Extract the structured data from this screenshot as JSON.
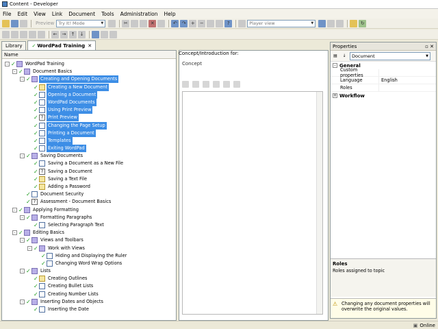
{
  "window": {
    "title": "Content - Developer"
  },
  "menu": [
    "File",
    "Edit",
    "View",
    "Link",
    "Document",
    "Tools",
    "Administration",
    "Help"
  ],
  "toolbar": {
    "preview_label": "Preview",
    "mode_combo": "Try It! Mode",
    "player_combo": "Player view"
  },
  "tabs": [
    {
      "label": "Library",
      "active": false
    },
    {
      "label": "WordPad Training",
      "active": true
    }
  ],
  "left_panel": {
    "column_header": "Name",
    "tree": [
      {
        "label": "WordPad Training",
        "level": 0,
        "expander": "-",
        "icon": "book",
        "selected": false
      },
      {
        "label": "Document Basics",
        "level": 1,
        "expander": "-",
        "icon": "book",
        "selected": false
      },
      {
        "label": "Creating and Opening Documents",
        "level": 2,
        "expander": "-",
        "icon": "book",
        "selected": true
      },
      {
        "label": "Creating a New Document",
        "level": 3,
        "expander": "",
        "icon": "quiz",
        "selected": true
      },
      {
        "label": "Opening a Document",
        "level": 3,
        "expander": "",
        "icon": "topic",
        "selected": true
      },
      {
        "label": "WordPad Documents",
        "level": 3,
        "expander": "",
        "icon": "topic",
        "selected": true
      },
      {
        "label": "Using Print Preview",
        "level": 3,
        "expander": "",
        "icon": "topic",
        "selected": true
      },
      {
        "label": "Print Preview",
        "level": 3,
        "expander": "",
        "icon": "tst",
        "selected": true
      },
      {
        "label": "Changing the Page Setup",
        "level": 3,
        "expander": "",
        "icon": "topic",
        "selected": true
      },
      {
        "label": "Printing a Document",
        "level": 3,
        "expander": "",
        "icon": "topic",
        "selected": true
      },
      {
        "label": "Templates",
        "level": 3,
        "expander": "",
        "icon": "topic",
        "selected": true
      },
      {
        "label": "Exiting WordPad",
        "level": 3,
        "expander": "",
        "icon": "topic",
        "selected": true
      },
      {
        "label": "Saving Documents",
        "level": 2,
        "expander": "-",
        "icon": "book",
        "selected": false
      },
      {
        "label": "Saving a Document as a New File",
        "level": 3,
        "expander": "",
        "icon": "topic",
        "selected": false
      },
      {
        "label": "Saving a Document",
        "level": 3,
        "expander": "",
        "icon": "tst",
        "selected": false
      },
      {
        "label": "Saving a Text File",
        "level": 3,
        "expander": "",
        "icon": "quiz",
        "selected": false
      },
      {
        "label": "Adding a Password",
        "level": 3,
        "expander": "",
        "icon": "quiz",
        "selected": false
      },
      {
        "label": "Document Security",
        "level": 2,
        "expander": "",
        "icon": "topic",
        "selected": false
      },
      {
        "label": "Assessment - Document Basics",
        "level": 2,
        "expander": "",
        "icon": "tst",
        "selected": false
      },
      {
        "label": "Applying Formatting",
        "level": 1,
        "expander": "-",
        "icon": "book",
        "selected": false
      },
      {
        "label": "Formatting Paragraphs",
        "level": 2,
        "expander": "-",
        "icon": "book",
        "selected": false
      },
      {
        "label": "Selecting Paragraph Text",
        "level": 3,
        "expander": "",
        "icon": "topic",
        "selected": false
      },
      {
        "label": "Editing Basics",
        "level": 1,
        "expander": "-",
        "icon": "book",
        "selected": false
      },
      {
        "label": "Views and Toolbars",
        "level": 2,
        "expander": "-",
        "icon": "book",
        "selected": false
      },
      {
        "label": "Work with Views",
        "level": 3,
        "expander": "-",
        "icon": "book",
        "selected": false
      },
      {
        "label": "Hiding and Displaying the Ruler",
        "level": 4,
        "expander": "",
        "icon": "topic",
        "selected": false
      },
      {
        "label": "Changing Word Wrap Options",
        "level": 4,
        "expander": "",
        "icon": "topic",
        "selected": false
      },
      {
        "label": "Lists",
        "level": 2,
        "expander": "-",
        "icon": "book",
        "selected": false
      },
      {
        "label": "Creating Outlines",
        "level": 3,
        "expander": "",
        "icon": "quiz",
        "selected": false
      },
      {
        "label": "Creating Bullet Lists",
        "level": 3,
        "expander": "",
        "icon": "topic",
        "selected": false
      },
      {
        "label": "Creating Number Lists",
        "level": 3,
        "expander": "",
        "icon": "topic",
        "selected": false
      },
      {
        "label": "Inserting Dates and Objects",
        "level": 2,
        "expander": "-",
        "icon": "book",
        "selected": false
      },
      {
        "label": "Inserting the Date",
        "level": 3,
        "expander": "",
        "icon": "topic",
        "selected": false
      }
    ]
  },
  "middle_panel": {
    "header": "Concept/Introduction for:",
    "concept_label": "Concept"
  },
  "properties": {
    "title": "Properties",
    "object_combo": "Document",
    "categories": [
      {
        "name": "General",
        "expander": "-",
        "rows": [
          {
            "key": "Custom properties",
            "value": ""
          },
          {
            "key": "Language",
            "value": "English"
          },
          {
            "key": "Roles",
            "value": ""
          }
        ]
      },
      {
        "name": "Workflow",
        "expander": "+",
        "rows": []
      }
    ],
    "description_title": "Roles",
    "description_text": "Roles assigned to topic",
    "warning_text": "Changing any document properties will overwrite the original values."
  },
  "status": {
    "text": "Online"
  },
  "colors": {
    "selection": "#3d8ee6",
    "check": "#1a9a1a"
  }
}
